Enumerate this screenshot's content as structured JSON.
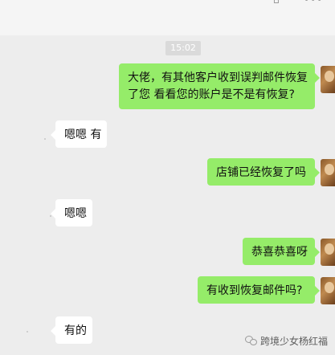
{
  "header": {
    "pin_icon": "pin-icon",
    "more_icon": "more-icon",
    "pin_glyph": "⌂",
    "more_glyph": "•••"
  },
  "timestamp": "15:02",
  "messages": [
    {
      "side": "out",
      "lines": [
        "大佬，有其他客户收到误判邮件恢复",
        "了您 看看您的账户是不是有恢复?"
      ]
    },
    {
      "side": "in",
      "text": "嗯嗯 有"
    },
    {
      "side": "out",
      "text": "店铺已经恢复了吗"
    },
    {
      "side": "in",
      "text": "嗯嗯"
    },
    {
      "side": "out",
      "text": "恭喜恭喜呀"
    },
    {
      "side": "out",
      "text": "有收到恢复邮件吗?"
    },
    {
      "side": "in",
      "text": "有的"
    }
  ],
  "watermark": {
    "text": "跨境少女杨红福",
    "icon": "wechat-icon"
  },
  "colors": {
    "background": "#ededed",
    "outgoing_bubble": "#95ec69",
    "incoming_bubble": "#ffffff"
  }
}
